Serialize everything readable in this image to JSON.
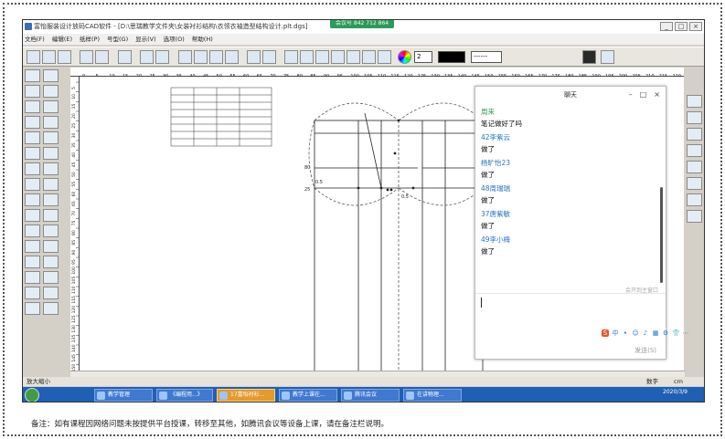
{
  "window": {
    "title": "富怡服装设计放码CAD软件 - [D:\\思瑞教学文件夹\\女装衬衫结构\\衣领衣袖造型结构设计.plt.dgs]",
    "meeting_badge": "会议号 842 712 864",
    "min": "_",
    "max": "□",
    "close": "×"
  },
  "menu": [
    "文档(F)",
    "编辑(E)",
    "纸样(P)",
    "号型(G)",
    "显示(V)",
    "选项(O)",
    "帮助(H)"
  ],
  "toolbar": {
    "color_indices": [
      "#2f72c9",
      "#5aa0e0",
      "#d8a020",
      "#999999",
      "#3a8f3a",
      "#3a8f3a",
      "#c23b3b",
      "#6e5fb0"
    ],
    "pen_width": "2",
    "line_style": "------",
    "ruler_ticks": [
      "0",
      "5",
      "10",
      "15",
      "20",
      "25",
      "30",
      "35",
      "40",
      "45",
      "50",
      "55",
      "60",
      "65",
      "70",
      "75",
      "80",
      "85",
      "90",
      "95",
      "100",
      "105",
      "110",
      "115",
      "120",
      "125",
      "130",
      "135",
      "140",
      "145",
      "150",
      "155",
      "160",
      "165",
      "170",
      "175",
      "180",
      "185",
      "190",
      "195",
      "200",
      "205",
      "210",
      "215",
      "220"
    ]
  },
  "ruler_left": [
    "5",
    "10",
    "15",
    "20",
    "25",
    "30",
    "35",
    "40",
    "45",
    "50",
    "55",
    "60",
    "65",
    "70",
    "75",
    "80",
    "85",
    "90",
    "95",
    "100",
    "105",
    "110",
    "115",
    "120",
    "125",
    "130",
    "135",
    "140",
    "145",
    "150"
  ],
  "canvas": {
    "labels": {
      "l80": "80",
      "l25": "25",
      "d1": "0.5",
      "d2": "0.5"
    }
  },
  "statusbar": {
    "left": "放大缩小",
    "numlock": "数字",
    "unit": "cm"
  },
  "taskbar": {
    "tasks": [
      {
        "label": "教学管理"
      },
      {
        "label": "《编程用...》"
      },
      {
        "label": "17富怡衬衫..."
      },
      {
        "label": "教学上课在..."
      },
      {
        "label": "腾讯会议"
      },
      {
        "label": "在讲物理..."
      }
    ],
    "clock_time": "",
    "clock_date": "2020/3/9"
  },
  "chat": {
    "title": "聊天",
    "messages": [
      {
        "name": "周来",
        "text": "笔记做好了吗"
      },
      {
        "name": "42李紫云",
        "text": "做了"
      },
      {
        "name": "杨旷怡23",
        "text": "做了"
      },
      {
        "name": "48周瑞瑞",
        "text": "做了"
      },
      {
        "name": "37唐紫敏",
        "text": "做了"
      },
      {
        "name": "49李小梅",
        "text": "做了"
      }
    ],
    "hint": "会开到主窗口",
    "send": "发送(S)",
    "ime": [
      "S",
      "中",
      "•",
      "☺",
      "♪",
      "▦",
      "⚙",
      "👕",
      "⋯"
    ]
  },
  "footer_notice": "备注：如有课程因网络问题未按提供平台授课，转移至其他，如腾讯会议等设备上课，请在备注栏说明。"
}
